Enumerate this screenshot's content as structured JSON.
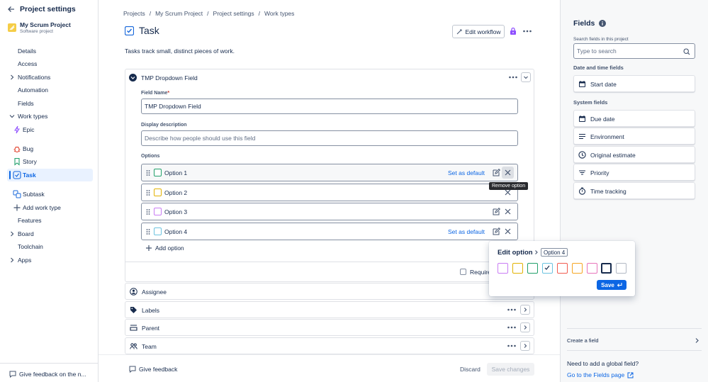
{
  "sidebar": {
    "back_title": "Project settings",
    "project_name": "My Scrum Project",
    "project_type": "Software project",
    "items": {
      "details": "Details",
      "access": "Access",
      "notifications": "Notifications",
      "automation": "Automation",
      "fields": "Fields",
      "work_types": "Work types",
      "epic": "Epic",
      "bug": "Bug",
      "story": "Story",
      "task": "Task",
      "subtask": "Subtask",
      "add_work_type": "Add work type",
      "features": "Features",
      "board": "Board",
      "toolchain": "Toolchain",
      "apps": "Apps"
    },
    "feedback": "Give feedback on the n..."
  },
  "breadcrumb": {
    "items": [
      "Projects",
      "My Scrum Project",
      "Project settings",
      "Work types"
    ],
    "sep": "/"
  },
  "page": {
    "title": "Task",
    "edit_workflow": "Edit workflow",
    "description": "Tasks track small, distinct pieces of work."
  },
  "field_card": {
    "title": "TMP Dropdown Field",
    "field_name_label": "Field Name",
    "required_mark": "*",
    "field_name_value": "TMP Dropdown Field",
    "display_desc_label": "Display description",
    "display_desc_placeholder": "Describe how people should use this field",
    "options_label": "Options",
    "options": [
      {
        "label": "Option 1",
        "color": "#22a06b",
        "set_default": "Set as default"
      },
      {
        "label": "Option 2",
        "color": "#e2b203",
        "set_default": ""
      },
      {
        "label": "Option 3",
        "color": "#c97cf4",
        "set_default": ""
      },
      {
        "label": "Option 4",
        "color": "#6cc3e0",
        "set_default": "Set as default"
      }
    ],
    "add_option": "Add option",
    "required_label": "Require",
    "tooltip": "Remove option"
  },
  "other_fields": [
    {
      "label": "Assignee",
      "icon": "person-icon"
    },
    {
      "label": "Labels",
      "icon": "tag-icon"
    },
    {
      "label": "Parent",
      "icon": "parent-icon"
    },
    {
      "label": "Team",
      "icon": "team-icon"
    }
  ],
  "footer": {
    "give_feedback": "Give feedback",
    "discard": "Discard",
    "save_changes": "Save changes"
  },
  "edit_option_popup": {
    "title": "Edit option",
    "option_name": "Option 4",
    "colors": [
      "#c97cf4",
      "#e2b203",
      "#22a06b",
      "#6cc3e0",
      "#f15b50",
      "#f5a623",
      "#e774bb",
      "#172b4d",
      "#b3b9c4"
    ],
    "save": "Save"
  },
  "right_panel": {
    "title": "Fields",
    "search_label": "Search fields in this project",
    "search_placeholder": "Type to search",
    "date_section": "Date and time fields",
    "date_fields": [
      "Start date"
    ],
    "system_section": "System fields",
    "system_fields": [
      "Due date",
      "Environment",
      "Original estimate",
      "Priority",
      "Time tracking"
    ],
    "create_field": "Create a field",
    "global_q": "Need to add a global field?",
    "go_fields": "Go to the Fields page"
  },
  "colors": {
    "accent": "#0c66e4",
    "selected_bg": "#e9f2ff"
  }
}
